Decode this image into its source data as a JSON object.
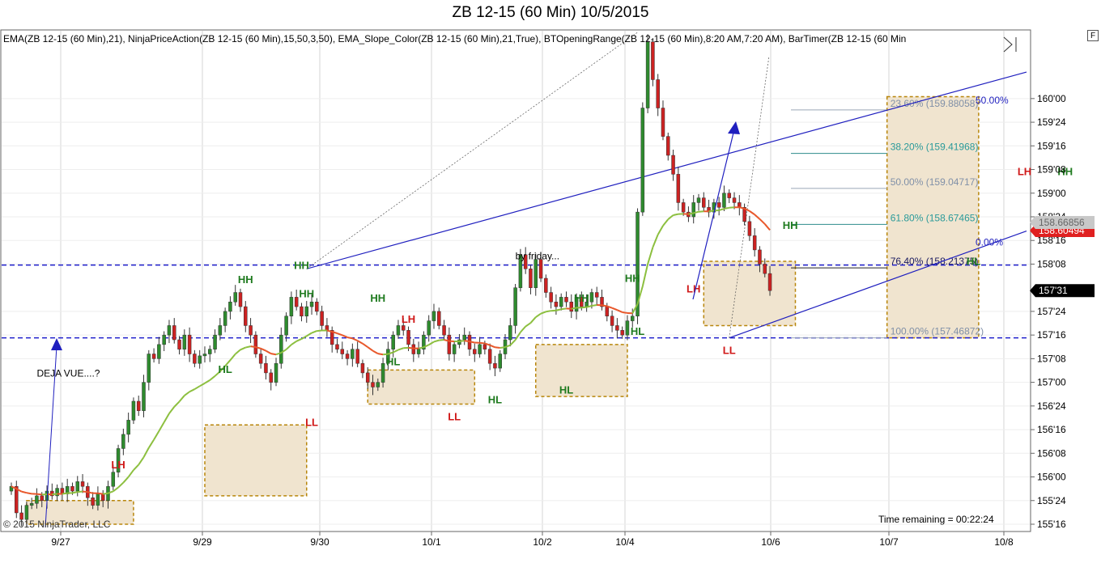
{
  "title": "ZB 12-15 (60 Min)  10/5/2015",
  "indicator_line": "EMA(ZB 12-15 (60 Min),21), NinjaPriceAction(ZB 12-15 (60 Min),15,50,3,50), EMA_Slope_Color(ZB 12-15 (60 Min),21,True), BTOpeningRange(ZB 12-15 (60 Min),8:20 AM,7:20 AM), BarTimer(ZB 12-15 (60 Min",
  "corner_button": "F",
  "copyright": "© 2015 NinjaTrader, LLC",
  "time_remaining": "Time remaining = 00:22:24",
  "colors": {
    "up_bar": "#2e8b2e",
    "down_bar": "#cc2222",
    "ema_up": "#8cbf3f",
    "ema_down": "#e8572a",
    "channel": "#1f1fbf",
    "level_line": "#1f1fcc",
    "box_fill": "#f0e4cf",
    "box_border": "#b8860b",
    "fib_line": "#2e8b8b",
    "price_tag_red": "#e02020",
    "price_tag_black": "#000000"
  },
  "chart_data": {
    "type": "candlestick",
    "instrument": "ZB 12-15",
    "interval": "60 Min",
    "x_ticks": [
      "9/27",
      "9/29",
      "9/30",
      "10/1",
      "10/2",
      "10/4",
      "10/6",
      "10/7",
      "10/8"
    ],
    "y_ticks": [
      "160'00",
      "159'24",
      "159'16",
      "159'08",
      "159'00",
      "158'24",
      "158'16",
      "158'08",
      "157'24",
      "157'16",
      "157'08",
      "157'00",
      "156'24",
      "156'16",
      "156'08",
      "156'00",
      "155'24",
      "155'16"
    ],
    "y_tick_values": [
      160.0,
      159.75,
      159.5,
      159.25,
      159.0,
      158.75,
      158.5,
      158.25,
      157.75,
      157.5,
      157.25,
      157.0,
      156.75,
      156.5,
      156.25,
      156.0,
      155.75,
      155.5
    ],
    "ylim": [
      155.44,
      160.7
    ],
    "price_tags": [
      {
        "text": "158.60494",
        "value": 158.605,
        "style": "red"
      },
      {
        "text": "158.66856",
        "value": 158.69,
        "style": "gray"
      },
      {
        "text": "157'31",
        "value": 157.97,
        "style": "black"
      }
    ],
    "closes": [
      155.9,
      155.62,
      155.55,
      155.7,
      155.72,
      155.8,
      155.75,
      155.85,
      155.8,
      155.88,
      155.82,
      155.9,
      155.85,
      155.95,
      155.9,
      155.78,
      155.7,
      155.82,
      155.75,
      155.9,
      156.05,
      156.3,
      156.45,
      156.6,
      156.8,
      156.7,
      157.0,
      157.3,
      157.25,
      157.4,
      157.5,
      157.6,
      157.45,
      157.35,
      157.5,
      157.3,
      157.2,
      157.28,
      157.3,
      157.35,
      157.5,
      157.6,
      157.75,
      157.85,
      157.95,
      157.8,
      157.6,
      157.5,
      157.3,
      157.2,
      157.1,
      157.0,
      157.2,
      157.5,
      157.7,
      157.9,
      157.8,
      157.7,
      157.8,
      157.85,
      157.75,
      157.6,
      157.55,
      157.4,
      157.35,
      157.3,
      157.25,
      157.35,
      157.2,
      157.1,
      157.0,
      156.95,
      157.0,
      157.2,
      157.35,
      157.5,
      157.6,
      157.55,
      157.4,
      157.3,
      157.35,
      157.5,
      157.65,
      157.75,
      157.6,
      157.5,
      157.3,
      157.4,
      157.45,
      157.5,
      157.35,
      157.3,
      157.4,
      157.35,
      157.2,
      157.15,
      157.3,
      157.45,
      157.6,
      158.0,
      158.35,
      158.2,
      158.0,
      158.3,
      158.1,
      157.95,
      157.85,
      157.8,
      157.9,
      157.85,
      157.75,
      157.9,
      157.8,
      157.85,
      157.95,
      157.9,
      157.8,
      157.7,
      157.6,
      157.55,
      157.5,
      157.65,
      157.7,
      158.8,
      159.9,
      160.6,
      160.2,
      159.9,
      159.6,
      159.4,
      159.2,
      158.9,
      158.8,
      158.75,
      158.9,
      158.95,
      158.85,
      158.8,
      158.9,
      158.85,
      159.0,
      158.95,
      158.9,
      158.85,
      158.7,
      158.55,
      158.4,
      158.25,
      158.15,
      157.97
    ],
    "annotations": [
      {
        "text": "HH",
        "type": "HH",
        "bar": 46,
        "value": 158.05
      },
      {
        "text": "HH",
        "type": "HH",
        "bar": 58,
        "value": 157.9
      },
      {
        "text": "HH",
        "type": "HH",
        "bar": 57,
        "value": 158.2
      },
      {
        "text": "HH",
        "type": "HH",
        "bar": 72,
        "value": 157.85
      },
      {
        "text": "HH",
        "type": "HH",
        "bar": 112,
        "value": 157.85
      },
      {
        "text": "HH",
        "type": "HH",
        "bar": 122,
        "value": 158.06
      },
      {
        "text": "HH",
        "type": "HH",
        "bar": 153,
        "value": 158.62
      },
      {
        "text": "HH",
        "type": "HH",
        "bar": 207,
        "value": 159.19
      },
      {
        "text": "LH",
        "type": "LH",
        "bar": 21,
        "value": 156.09
      },
      {
        "text": "LH",
        "type": "LH",
        "bar": 78,
        "value": 157.63
      },
      {
        "text": "LH",
        "type": "LH",
        "bar": 134,
        "value": 157.95
      },
      {
        "text": "LH",
        "type": "LH",
        "bar": 199,
        "value": 159.19
      },
      {
        "text": "HL",
        "type": "HL",
        "bar": 42,
        "value": 157.1
      },
      {
        "text": "HL",
        "type": "HL",
        "bar": 75,
        "value": 157.18
      },
      {
        "text": "HL",
        "type": "HL",
        "bar": 95,
        "value": 156.78
      },
      {
        "text": "HL",
        "type": "HL",
        "bar": 109,
        "value": 156.88
      },
      {
        "text": "HL",
        "type": "HL",
        "bar": 123,
        "value": 157.5
      },
      {
        "text": "HL",
        "type": "HL",
        "bar": 189,
        "value": 158.24
      },
      {
        "text": "LL",
        "type": "LL",
        "bar": 59,
        "value": 156.54
      },
      {
        "text": "LL",
        "type": "LL",
        "bar": 87,
        "value": 156.6
      },
      {
        "text": "LL",
        "type": "LL",
        "bar": 141,
        "value": 157.3
      }
    ],
    "text_notes": [
      {
        "text": "DEJA VUE....?",
        "bar": 5,
        "value": 157.06
      },
      {
        "text": "by friday...",
        "bar": 99,
        "value": 158.3
      }
    ],
    "fib_levels": [
      {
        "label": "23.60% (159.88058)",
        "value": 159.88
      },
      {
        "label": "38.20% (159.41968)",
        "value": 159.42
      },
      {
        "label": "50.00% (159.04717)",
        "value": 159.05
      },
      {
        "label": "61.80% (158.67465)",
        "value": 158.67
      },
      {
        "label": "76.40% (158.21375)",
        "value": 158.21
      },
      {
        "label": "100.00% (157.46872)",
        "value": 157.47
      }
    ],
    "horizontal_levels": [
      158.24,
      157.47
    ],
    "channel_labels": [
      {
        "text": "50.00%",
        "value": 159.98
      },
      {
        "text": "0.00%",
        "value": 158.48
      }
    ]
  }
}
